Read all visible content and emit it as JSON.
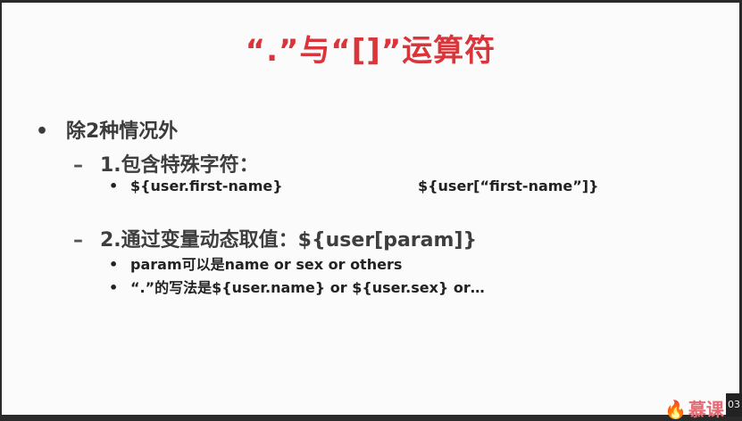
{
  "slide": {
    "title": "“.”与“[]”运算符",
    "bullet1": "除2种情况外",
    "sub1": {
      "label": "1.包含特殊字符：",
      "items": [
        "${user.first-name}",
        "${user[“first-name”]}"
      ]
    },
    "sub2": {
      "label": "2.通过变量动态取值：${user[param]}",
      "items": [
        "param可以是name or sex or others",
        "“.”的写法是${user.name} or ${user.sex} or…"
      ]
    }
  },
  "logo": {
    "icon": "flame-icon",
    "text": "慕课"
  },
  "timecode": "03"
}
